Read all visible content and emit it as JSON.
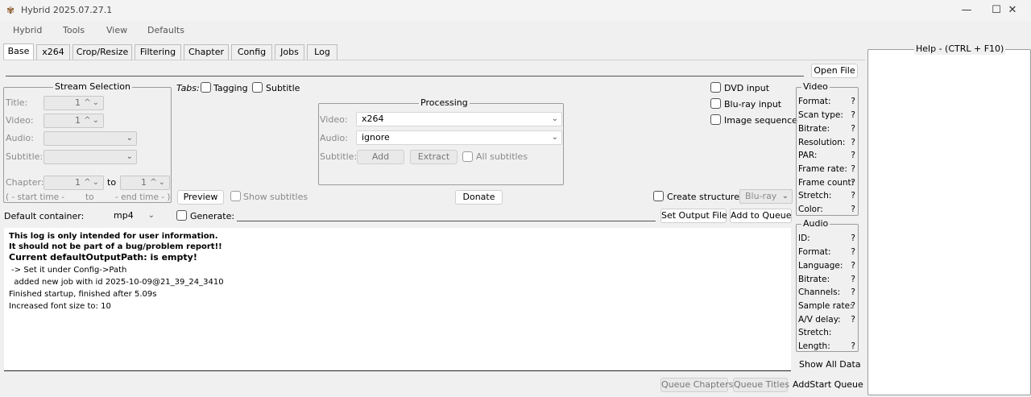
{
  "window": {
    "title": "Hybrid 2025.07.27.1",
    "minimize": "—",
    "maximize": "☐",
    "close": "✕"
  },
  "menu": [
    "Hybrid",
    "Tools",
    "View",
    "Defaults"
  ],
  "tabs": [
    "Base",
    "x264",
    "Crop/Resize",
    "Filtering",
    "Chapter",
    "Config",
    "Jobs",
    "Log"
  ],
  "file": {
    "path": "",
    "open_label": "Open File"
  },
  "stream_selection": {
    "title": "Stream Selection",
    "title_label": "Title:",
    "title_value": "1",
    "video_label": "Video:",
    "video_value": "1",
    "audio_label": "Audio:",
    "subtitle_label": "Subtitle:",
    "chapter_label": "Chapter:",
    "chapter_from": "1",
    "to_label": "to",
    "chapter_to": "1",
    "start_time": "( - start time -",
    "to_small": "to",
    "end_time": "- end time - )"
  },
  "tabs_options": {
    "label": "Tabs:",
    "tagging": "Tagging",
    "subtitle": "Subtitle"
  },
  "processing": {
    "title": "Processing",
    "video_label": "Video:",
    "video_value": "x264",
    "audio_label": "Audio:",
    "audio_value": "ignore",
    "subtitle_label": "Subtitle:",
    "add_label": "Add",
    "extract_label": "Extract",
    "all_subtitles": "All subtitles"
  },
  "inputs": {
    "dvd": "DVD input",
    "bluray": "Blu-ray input",
    "image_sequence": "Image sequence"
  },
  "preview": {
    "label": "Preview",
    "show_subtitles": "Show subtitles"
  },
  "donate_label": "Donate",
  "structure": {
    "label": "Create structure:",
    "value": "Blu-ray"
  },
  "output": {
    "container_label": "Default container:",
    "container_value": "mp4",
    "generate_label": "Generate:",
    "set_output": "Set Output File",
    "add_queue": "Add to Queue"
  },
  "log": {
    "lines": [
      "This log is only intended for user information.",
      "It should not be part of a bug/problem report!!",
      "Current defaultOutputPath:  is empty!",
      " -> Set it under Config->Path",
      "  added new job with id 2025-10-09@21_39_24_3410",
      "Finished startup, finished after 5.09s",
      "Increased font size to: 10"
    ]
  },
  "video_info": {
    "title": "Video",
    "items": [
      "Format:",
      "Scan type:",
      "Bitrate:",
      "Resolution:",
      "PAR:",
      "Frame rate:",
      "Frame count:",
      "Stretch:",
      "Color:"
    ],
    "values": [
      "?",
      "?",
      "?",
      "?",
      "?",
      "?",
      "?",
      "?",
      "?"
    ]
  },
  "audio_info": {
    "title": "Audio",
    "items": [
      "ID:",
      "Format:",
      "Language:",
      "Bitrate:",
      "Channels:",
      "Sample rate:",
      "A/V delay:",
      "Stretch:",
      "Length:"
    ],
    "values": [
      "?",
      "?",
      "?",
      "?",
      "?",
      "?",
      "?",
      "",
      "?"
    ]
  },
  "show_all_data": "Show All Data",
  "queue": {
    "chapters": "Queue Chapters",
    "titles": "Queue Titles",
    "add_start": "AddStart Queue"
  },
  "help": {
    "title": "Help - (CTRL + F10)"
  }
}
